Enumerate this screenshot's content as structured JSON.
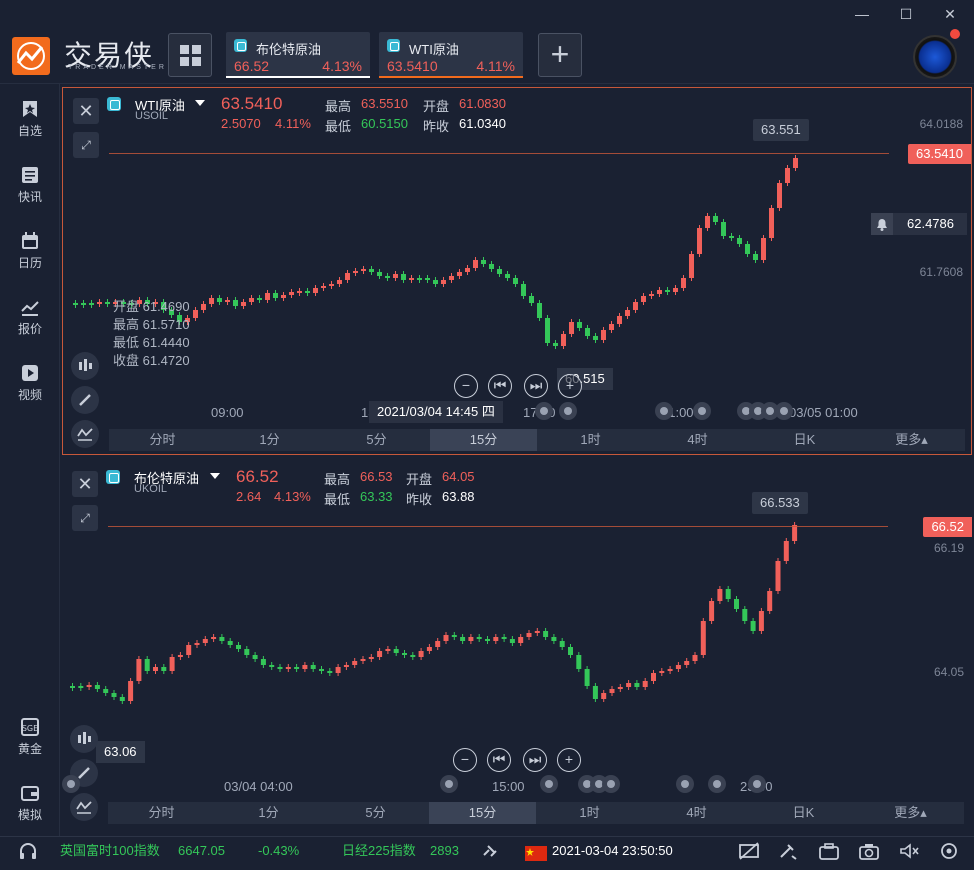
{
  "app": {
    "logo_text": "交易侠",
    "logo_sub": "TRADER MASTER",
    "window_controls": {
      "min": "—",
      "max": "☐",
      "close": "✕"
    }
  },
  "tabs": [
    {
      "name": "布伦特原油",
      "price": "66.52",
      "pct": "4.13%"
    },
    {
      "name": "WTI原油",
      "price": "63.5410",
      "pct": "4.11%"
    }
  ],
  "sidebar": {
    "items": [
      {
        "label": "自选",
        "icon": "star-bookmark-icon"
      },
      {
        "label": "快讯",
        "icon": "news-icon"
      },
      {
        "label": "日历",
        "icon": "calendar-icon"
      },
      {
        "label": "报价",
        "icon": "quote-chart-icon"
      },
      {
        "label": "视频",
        "icon": "video-icon"
      },
      {
        "label": "黄金",
        "icon": "gold-icon"
      },
      {
        "label": "模拟",
        "icon": "wallet-icon"
      }
    ]
  },
  "periods": [
    "分时",
    "1分",
    "5分",
    "15分",
    "1时",
    "4时",
    "日K",
    "更多▴"
  ],
  "active_period": "15分",
  "panel1": {
    "name": "WTI原油",
    "code": "USOIL",
    "price": "63.5410",
    "change": "2.5070",
    "pct": "4.11%",
    "high_label": "最高",
    "high": "63.5510",
    "open_label": "开盘",
    "open": "61.0830",
    "low_label": "最低",
    "low": "60.5150",
    "prev_label": "昨收",
    "prev": "61.0340",
    "ohlc": [
      "开盘 61.4690",
      "最高 61.5710",
      "最低 61.4440",
      "收盘 61.4720"
    ],
    "y_labels": [
      "64.0188",
      "61.7608"
    ],
    "price_tag": "63.5410",
    "alert_price": "62.4786",
    "high_tag": "63.551",
    "low_tag": "60.515",
    "cross_time": "2021/03/04 14:45 四",
    "x_labels": [
      "09:00",
      "13",
      "17:00",
      "21:00",
      "03/05 01:00"
    ]
  },
  "panel2": {
    "name": "布伦特原油",
    "code": "UKOIL",
    "price": "66.52",
    "change": "2.64",
    "pct": "4.13%",
    "high_label": "最高",
    "high": "66.53",
    "open_label": "开盘",
    "open": "64.05",
    "low_label": "最低",
    "low": "63.33",
    "prev_label": "昨收",
    "prev": "63.88",
    "y_labels": [
      "66.19",
      "64.05"
    ],
    "price_tag": "66.52",
    "high_tag": "66.533",
    "low_tag": "63.06",
    "x_labels": [
      "03/04 04:00",
      "15:00",
      "23:00"
    ]
  },
  "ticker": {
    "item1_name": "英国富时100指数",
    "item1_value": "6647.05",
    "item1_pct": "-0.43%",
    "item2_name": "日经225指数",
    "item2_value": "2893",
    "datetime": "2021-03-04 23:50:50"
  },
  "colors": {
    "up": "#f0605a",
    "down": "#34c759",
    "accent": "#f26b1d",
    "background": "#1a2132"
  }
}
